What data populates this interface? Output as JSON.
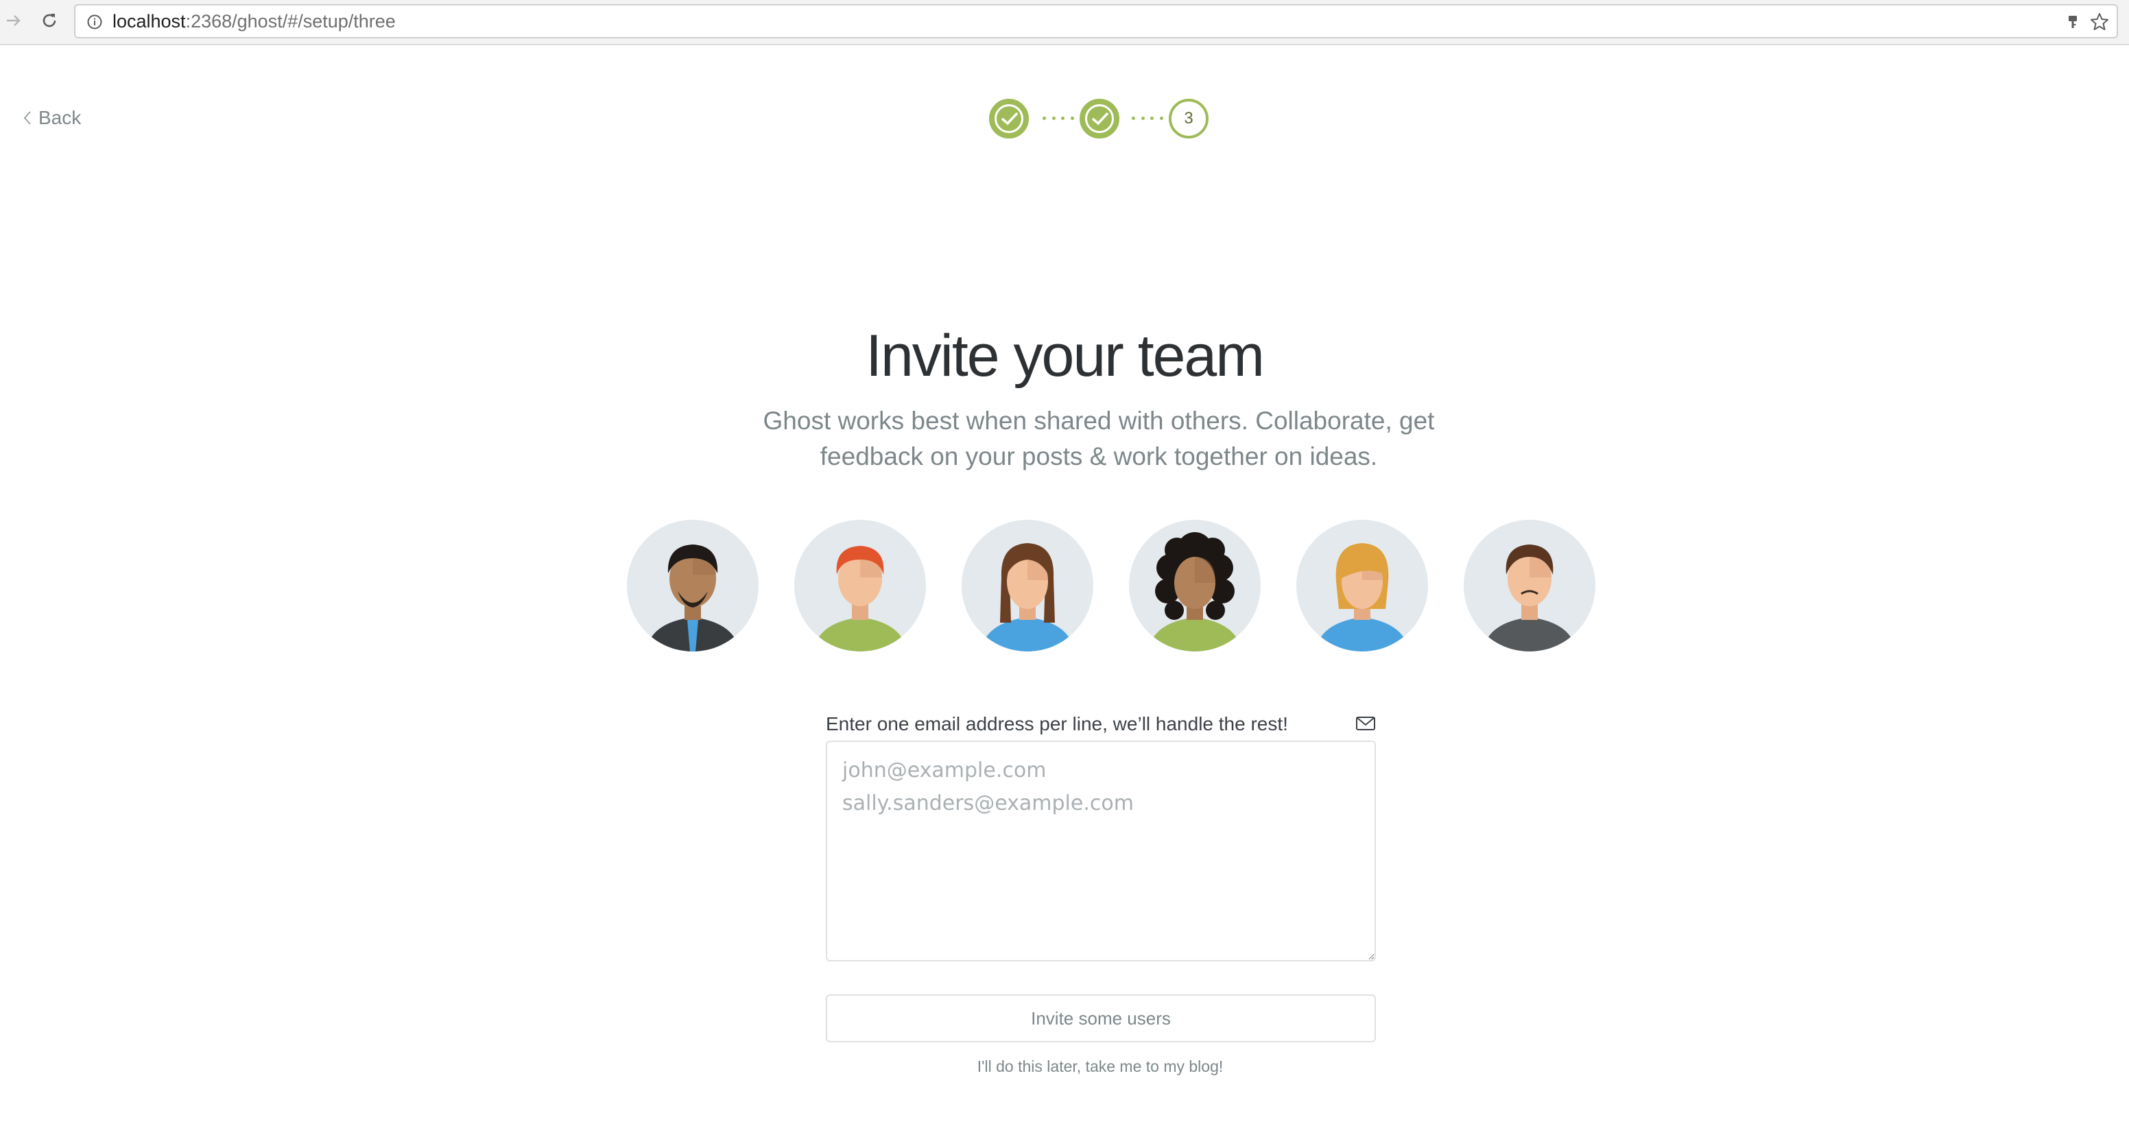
{
  "browser": {
    "url_host": "localhost",
    "url_path": ":2368/ghost/#/setup/three",
    "icons": [
      "forward-icon",
      "reload-icon",
      "info-icon",
      "key-icon",
      "star-icon"
    ]
  },
  "header": {
    "back_label": "Back",
    "steps": [
      {
        "state": "done"
      },
      {
        "state": "done"
      },
      {
        "state": "active",
        "label": "3"
      }
    ]
  },
  "main": {
    "title": "Invite your team",
    "subtitle_line1": "Ghost works best when shared with others. Collaborate, get",
    "subtitle_line2": "feedback on your posts & work together on ideas.",
    "avatars": [
      "man-beard-tie",
      "redhead-man",
      "brunette-pigtails",
      "curly-hair-woman",
      "blonde-woman",
      "brown-hair-man"
    ]
  },
  "form": {
    "label": "Enter one email address per line, we’ll handle the rest!",
    "placeholder": "john@example.com\nsally.sanders@example.com",
    "invite_label": "Invite some users",
    "skip_label": "I'll do this later, take me to my blog!"
  },
  "colors": {
    "accent": "#9fbb58",
    "muted_text": "#7d878a",
    "avatar_bg": "#e3e9ed"
  }
}
